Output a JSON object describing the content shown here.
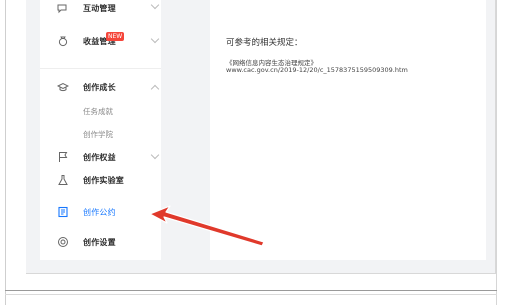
{
  "sidebar": {
    "items": [
      {
        "label": "互动管理",
        "icon": "chat-icon"
      },
      {
        "label": "收益管理",
        "icon": "money-bag-icon",
        "badge": "NEW"
      },
      {
        "label": "创作成长",
        "icon": "graduation-cap-icon"
      },
      {
        "label": "创作权益",
        "icon": "flag-icon"
      },
      {
        "label": "创作实验室",
        "icon": "flask-icon"
      },
      {
        "label": "创作公约",
        "icon": "document-icon"
      },
      {
        "label": "创作设置",
        "icon": "settings-icon"
      }
    ],
    "sub_items": [
      "任务成就",
      "创作学院"
    ]
  },
  "content": {
    "title": "可参考的相关规定：",
    "regulation_name": "《网络信息内容生态治理规定》",
    "regulation_url": "www.cac.gov.cn/2019-12/20/c_1578375159509309.htm"
  },
  "colors": {
    "accent": "#1677ff",
    "badge": "#f5453a",
    "arrow": "#e0392b",
    "arrow_border": "#ffffff"
  }
}
